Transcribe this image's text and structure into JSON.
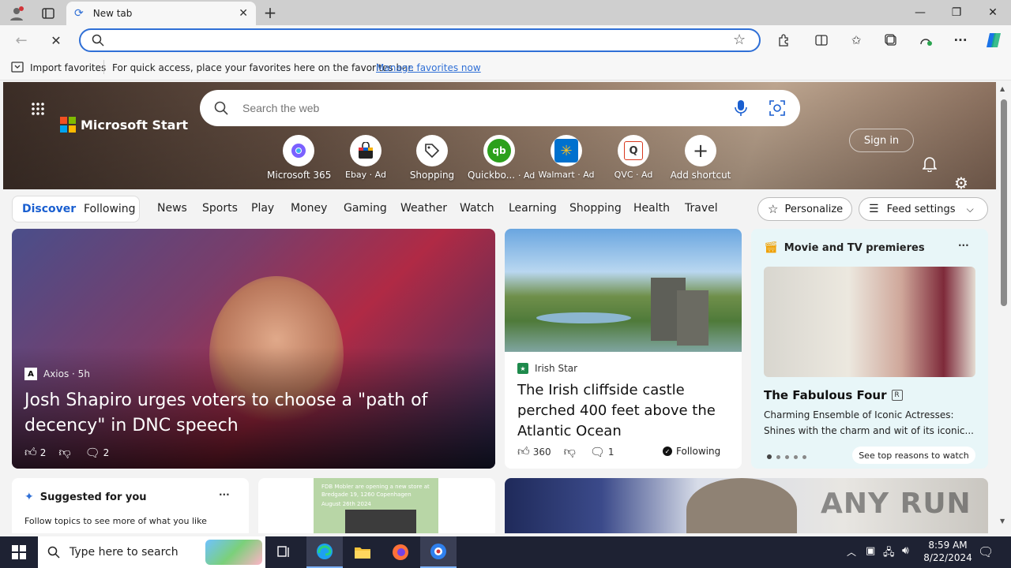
{
  "browser": {
    "tab_title": "New tab",
    "new_tab_icon": "plus-icon",
    "address_value": "",
    "import_favorites": "Import favorites",
    "fav_hint": "For quick access, place your favorites here on the favorites bar.",
    "manage_link": "Manage favorites now"
  },
  "header": {
    "brand": "Microsoft Start",
    "search_placeholder": "Search the web",
    "sign_in": "Sign in"
  },
  "shortcuts": [
    {
      "label": "Microsoft 365",
      "icon": "m365-icon",
      "color": "#7b61ff"
    },
    {
      "label": "Ebay · Ad",
      "icon": "ebay-bag-icon",
      "color": "#e53238"
    },
    {
      "label": "Shopping",
      "icon": "tag-icon",
      "color": "#333333"
    },
    {
      "label": "Quickbo...",
      "ad": "· Ad",
      "icon": "qb-icon",
      "color": "#2ca01c"
    },
    {
      "label": "Walmart · Ad",
      "icon": "walmart-spark-icon",
      "color": "#0071ce"
    },
    {
      "label": "QVC · Ad",
      "icon": "qvc-icon",
      "color": "#d9381e"
    },
    {
      "label": "Add shortcut",
      "icon": "plus-icon",
      "color": "#555555"
    }
  ],
  "nav": {
    "discover": "Discover",
    "following": "Following",
    "items": [
      "News",
      "Sports",
      "Play",
      "Money",
      "Gaming",
      "Weather",
      "Watch",
      "Learning",
      "Shopping",
      "Health",
      "Travel"
    ],
    "personalize": "Personalize",
    "feed_settings": "Feed settings"
  },
  "main_story": {
    "source": "Axios · 5h",
    "headline": "Josh Shapiro urges voters to choose a \"path of decency\" in DNC speech",
    "likes": "2",
    "comments": "2"
  },
  "story2": {
    "source": "Irish Star",
    "headline": "The Irish cliffside castle perched 400 feet above the Atlantic Ocean",
    "likes": "360",
    "comments": "1",
    "following": "Following"
  },
  "movie_card": {
    "title": "Movie and TV premieres",
    "show": "The Fabulous Four",
    "rating": "R",
    "desc": "Charming Ensemble of Iconic Actresses: Shines with the charm and wit of its iconic...",
    "cta": "See top reasons to watch"
  },
  "suggested": {
    "title": "Suggested for you",
    "sub": "Follow topics to see more of what you like"
  },
  "thumb_text": "FDB Mobler are opening a new store at Bredgade 19, 1260 Copenhagen",
  "thumb_date": "August 26th 2024",
  "watermark": "ANY RUN",
  "taskbar": {
    "search_placeholder": "Type here to search",
    "time": "8:59 AM",
    "date": "8/22/2024"
  },
  "colors": {
    "accent": "#2f6fd6",
    "taskbar": "#1e2233"
  }
}
